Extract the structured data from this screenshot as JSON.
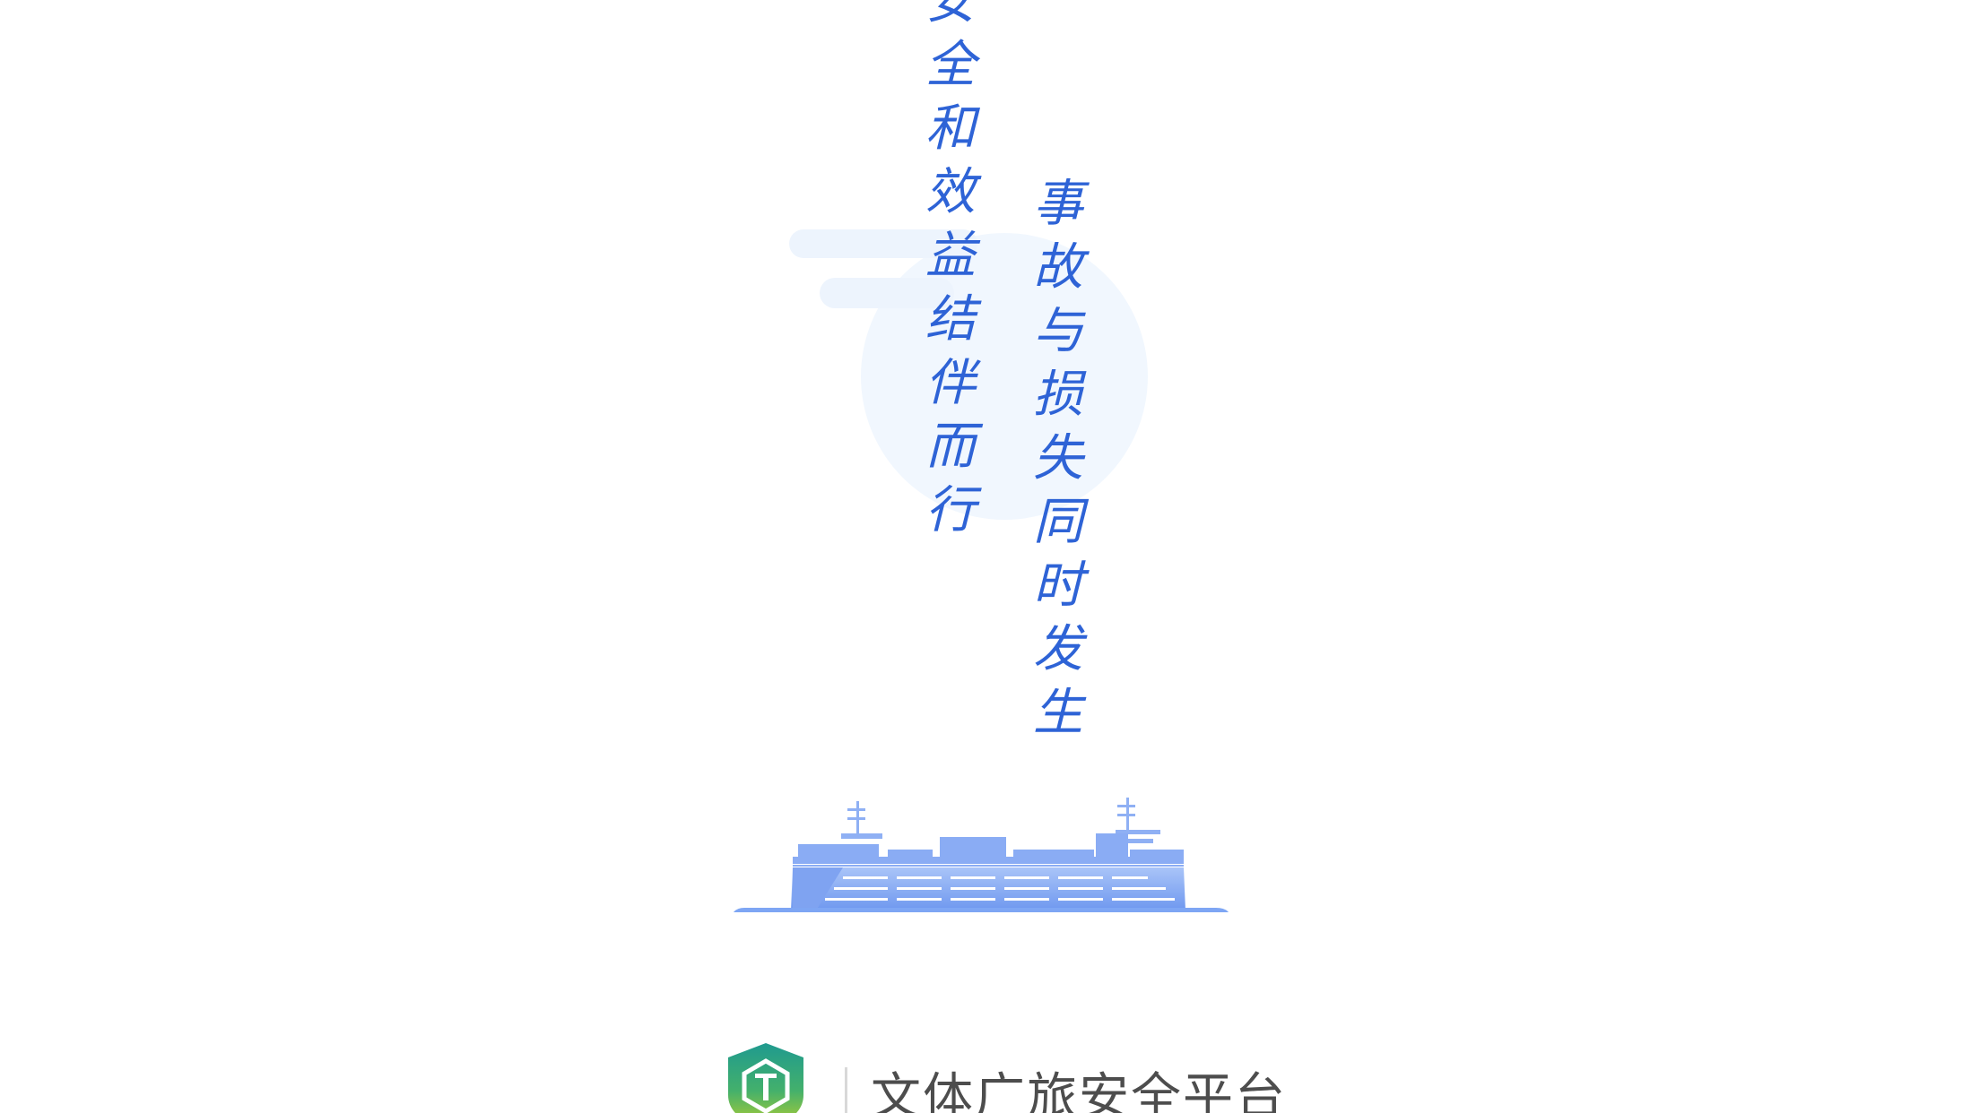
{
  "slogan": {
    "left_column": [
      "安",
      "全",
      "和",
      "效",
      "益",
      "结",
      "伴",
      "而",
      "行"
    ],
    "right_column": [
      "事",
      "故",
      "与",
      "损",
      "失",
      "同",
      "时",
      "发",
      "生"
    ]
  },
  "footer": {
    "platform_name": "文体广旅安全平台"
  },
  "colors": {
    "slogan_text": "#2e63d6",
    "ship": "#7ea6f4",
    "cloud": "#eef5fd",
    "footer_text": "#4d4d4d"
  },
  "icons": {
    "ship": "ship-illustration",
    "logo": "shield-logo-icon"
  }
}
